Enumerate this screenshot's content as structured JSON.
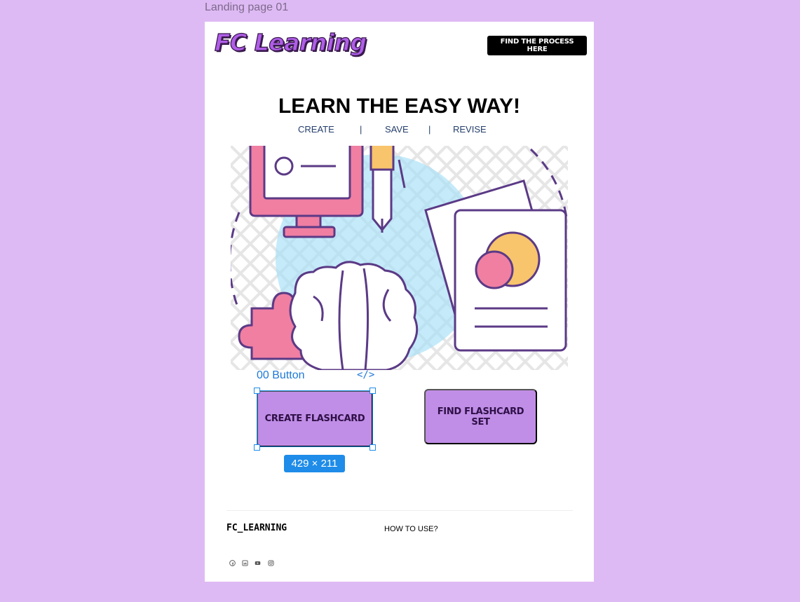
{
  "frame": {
    "label": "Landing page 01"
  },
  "header": {
    "logo": "FC Learning",
    "process_button": "FIND THE PROCESS HERE"
  },
  "hero": {
    "title": "LEARN THE EASY WAY!",
    "steps": [
      "CREATE",
      "SAVE",
      "REVISE"
    ],
    "separator": "|"
  },
  "editor": {
    "component_label": "00 Button",
    "code_icon": "</>",
    "selection_size": "429 × 211"
  },
  "actions": {
    "create_label": "CREATE FLASHCARD",
    "find_label": "FIND FLASHCARD SET"
  },
  "footer": {
    "brand": "FC_LEARNING",
    "link": "HOW TO USE?",
    "social_icons": [
      "facebook-icon",
      "linkedin-icon",
      "youtube-icon",
      "instagram-icon"
    ]
  },
  "colors": {
    "canvas_bg": "#debaf4",
    "button_fill": "#c08ee6",
    "selection_blue": "#1e8ce8",
    "logo_purple": "#b05ee8"
  }
}
